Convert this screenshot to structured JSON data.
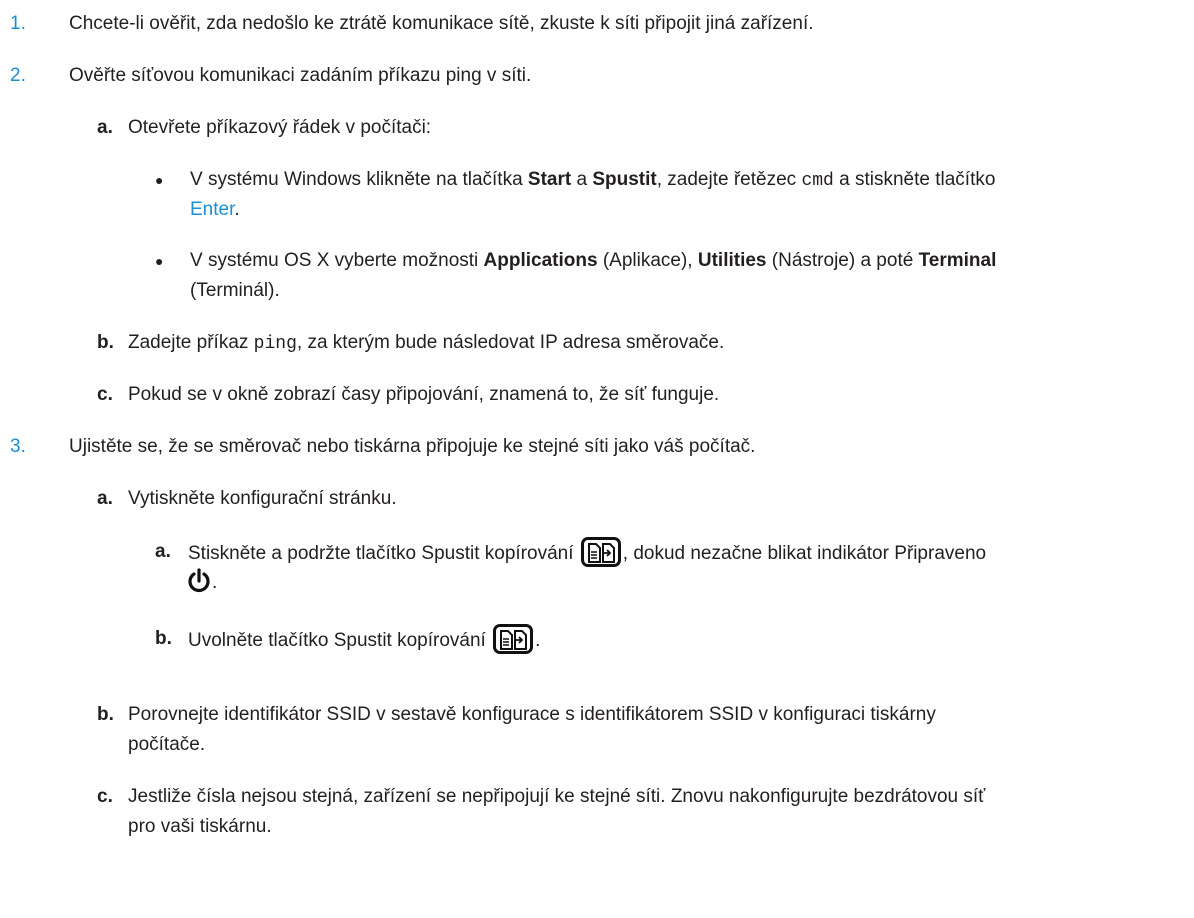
{
  "steps": [
    {
      "num": "1.",
      "text": "Chcete-li ověřit, zda nedošlo ke ztrátě komunikace sítě, zkuste k síti připojit jiná zařízení."
    },
    {
      "num": "2.",
      "text": "Ověřte síťovou komunikaci zadáním příkazu ping v síti."
    },
    {
      "num": "3.",
      "text": "Ujistěte se, že se směrovač nebo tiskárna připojuje ke stejné síti jako váš počítač."
    }
  ],
  "step2": {
    "a": {
      "label": "a.",
      "text": "Otevřete příkazový řádek v počítači:"
    },
    "bullet1": {
      "t1": "V systému Windows klikněte na tlačítka ",
      "start": "Start",
      "t2": " a ",
      "spustit": "Spustit",
      "t3": ", zadejte řetězec ",
      "cmd": "cmd",
      "t4": " a stiskněte tlačítko",
      "enter": "Enter",
      "t5": "."
    },
    "bullet2": {
      "t1": "V systému OS X vyberte možnosti ",
      "applications": "Applications",
      "t2": " (Aplikace), ",
      "utilities": "Utilities",
      "t3": " (Nástroje) a poté ",
      "terminal": "Terminal",
      "t4": "(Terminál)."
    },
    "b": {
      "label": "b.",
      "t1": "Zadejte příkaz ",
      "ping": "ping",
      "t2": ", za kterým bude následovat IP adresa směrovače."
    },
    "c": {
      "label": "c.",
      "text": "Pokud se v okně zobrazí časy připojování, znamená to, že síť funguje."
    }
  },
  "step3": {
    "a": {
      "label": "a.",
      "text": "Vytiskněte konfigurační stránku."
    },
    "sub_a": {
      "label": "a.",
      "t1": "Stiskněte a podržte tlačítko Spustit kopírování ",
      "t2": ", dokud nezačne blikat indikátor Připraveno",
      "t3": "."
    },
    "sub_b": {
      "label": "b.",
      "t1": "Uvolněte tlačítko Spustit kopírování ",
      "t2": "."
    },
    "b": {
      "label": "b.",
      "line1": "Porovnejte identifikátor SSID v sestavě konfigurace s identifikátorem SSID v konfiguraci tiskárny",
      "line2": "počítače."
    },
    "c": {
      "label": "c.",
      "line1": "Jestliže čísla nejsou stejná, zařízení se nepřipojují ke stejné síti. Znovu nakonfigurujte bezdrátovou síť",
      "line2": "pro vaši tiskárnu."
    }
  },
  "icons": {
    "bullet": "●",
    "copy": "start-copy-icon",
    "ready": "power-ready-icon"
  },
  "colors": {
    "accent": "#1a8fd6",
    "text": "#231f20"
  }
}
